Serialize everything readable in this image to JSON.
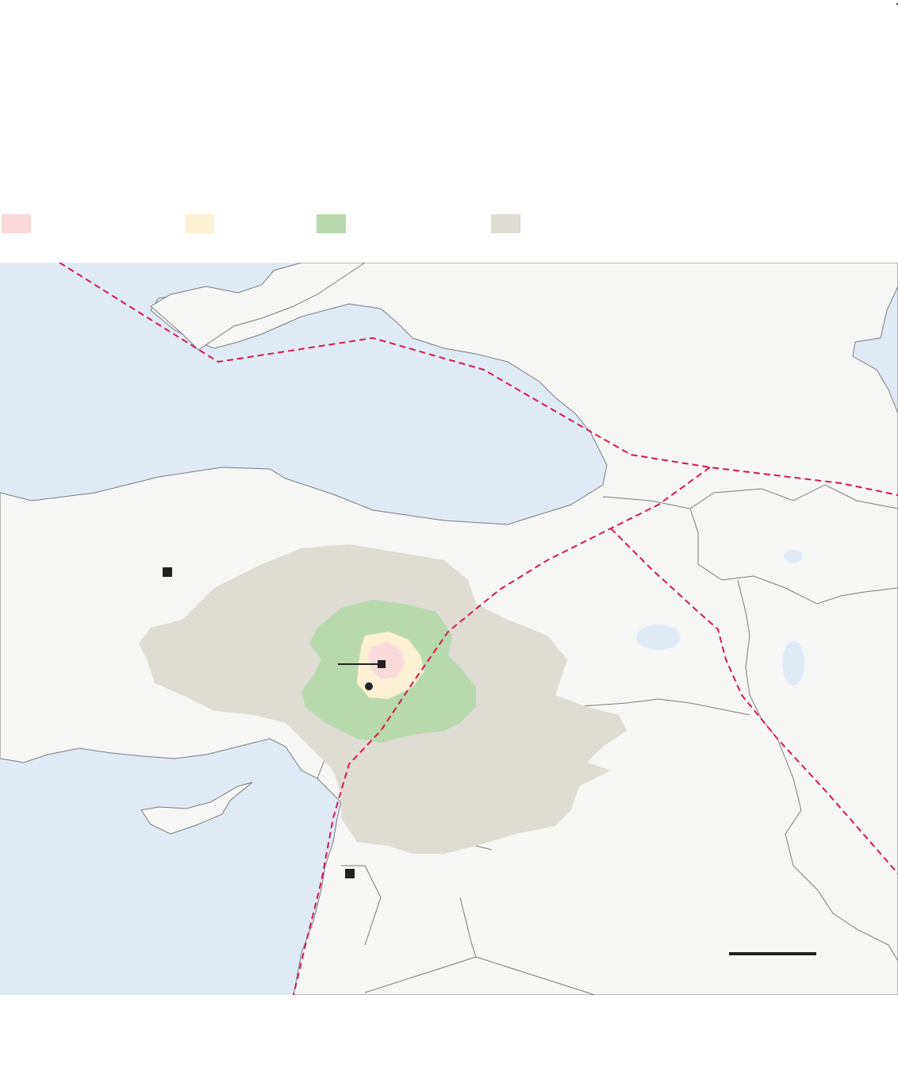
{
  "legend": {
    "items": [
      {
        "key": "severe",
        "label": "",
        "color": "#f9d9d9"
      },
      {
        "key": "strong",
        "label": "",
        "color": "#fdf0d5"
      },
      {
        "key": "moderate",
        "label": "",
        "color": "#b8d9ad"
      },
      {
        "key": "light",
        "label": "",
        "color": "#dedcd3"
      }
    ]
  },
  "map": {
    "colors": {
      "sea": "#dfeaf6",
      "land": "#f6f6f4",
      "border": "#7a7a7a",
      "fault_line": "#d6174f",
      "marker": "#222222"
    },
    "icons": {
      "city_marker": "square-marker",
      "epicenter": "circle-marker"
    }
  }
}
